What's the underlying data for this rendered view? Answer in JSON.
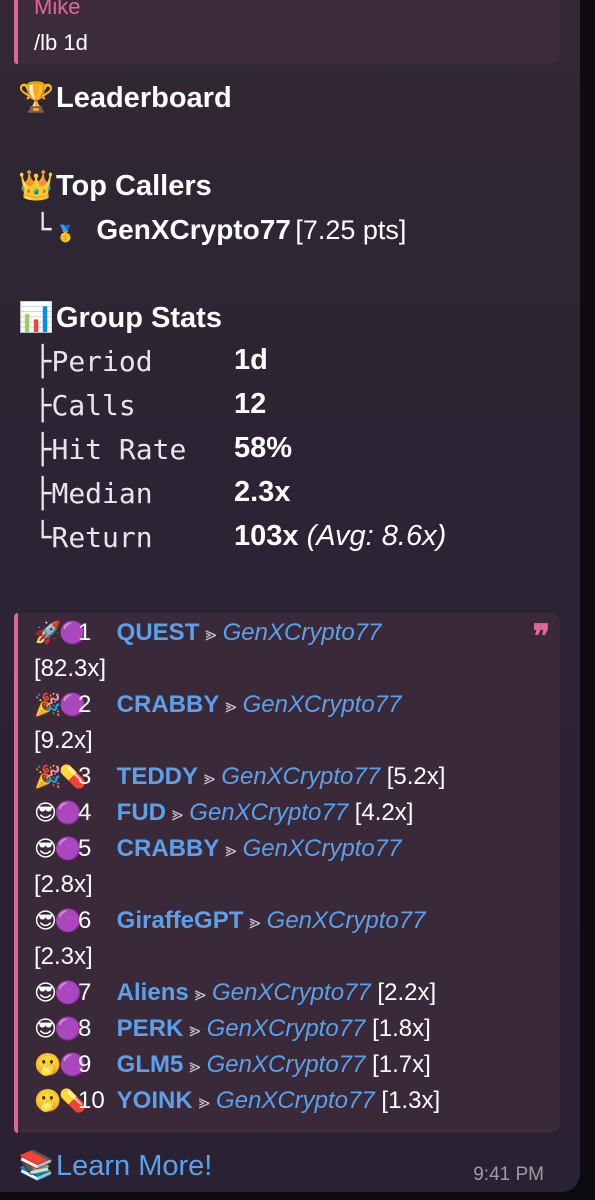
{
  "reply": {
    "name": "Mike",
    "text": "/lb 1d"
  },
  "leaderboard": {
    "icon": "🏆",
    "title": "Leaderboard"
  },
  "top_callers": {
    "icon": "👑",
    "title": "Top Callers",
    "entries": [
      {
        "tree": "└",
        "medal": "🥇",
        "name": "GenXCrypto77",
        "points": "[7.25 pts]"
      }
    ]
  },
  "group_stats": {
    "icon": "📊",
    "title": "Group Stats",
    "rows": [
      {
        "tree": "├",
        "label": "Period",
        "value": "1d",
        "extra": ""
      },
      {
        "tree": "├",
        "label": "Calls",
        "value": "12",
        "extra": ""
      },
      {
        "tree": "├",
        "label": "Hit Rate",
        "value": "58%",
        "extra": ""
      },
      {
        "tree": "├",
        "label": "Median",
        "value": "2.3x",
        "extra": ""
      },
      {
        "tree": "└",
        "label": "Return",
        "value": "103x",
        "extra": "(Avg: 8.6x)"
      }
    ]
  },
  "calls": {
    "quote_mark": "❞",
    "separator": "⪢",
    "items": [
      {
        "emoji": "🚀🟣",
        "rank": "1",
        "token": "QUEST",
        "caller": "GenXCrypto77",
        "mult": "[82.3x]"
      },
      {
        "emoji": "🎉🟣",
        "rank": "2",
        "token": "CRABBY",
        "caller": "GenXCrypto77",
        "mult": "[9.2x]"
      },
      {
        "emoji": "🎉💊",
        "rank": "3",
        "token": "TEDDY",
        "caller": "GenXCrypto77",
        "mult": "[5.2x]"
      },
      {
        "emoji": "😎🟣",
        "rank": "4",
        "token": "FUD",
        "caller": "GenXCrypto77",
        "mult": "[4.2x]"
      },
      {
        "emoji": "😎🟣",
        "rank": "5",
        "token": "CRABBY",
        "caller": "GenXCrypto77",
        "mult": "[2.8x]"
      },
      {
        "emoji": "😎🟣",
        "rank": "6",
        "token": "GiraffeGPT",
        "caller": "GenXCrypto77",
        "mult": "[2.3x]"
      },
      {
        "emoji": "😎🟣",
        "rank": "7",
        "token": "Aliens",
        "caller": "GenXCrypto77",
        "mult": "[2.2x]"
      },
      {
        "emoji": "😎🟣",
        "rank": "8",
        "token": "PERK",
        "caller": "GenXCrypto77",
        "mult": "[1.8x]"
      },
      {
        "emoji": "🫢🟣",
        "rank": "9",
        "token": "GLM5",
        "caller": "GenXCrypto77",
        "mult": "[1.7x]"
      },
      {
        "emoji": "🫢💊",
        "rank": "10",
        "token": "YOINK",
        "caller": "GenXCrypto77",
        "mult": "[1.3x]"
      }
    ]
  },
  "footer": {
    "icon": "📚",
    "link": "Learn More!",
    "time": "9:41 PM"
  },
  "colors": {
    "accent": "#e0669a",
    "link": "#5aa0ea",
    "bubble": "#2c2434",
    "quote_bg": "#3a2a39"
  }
}
